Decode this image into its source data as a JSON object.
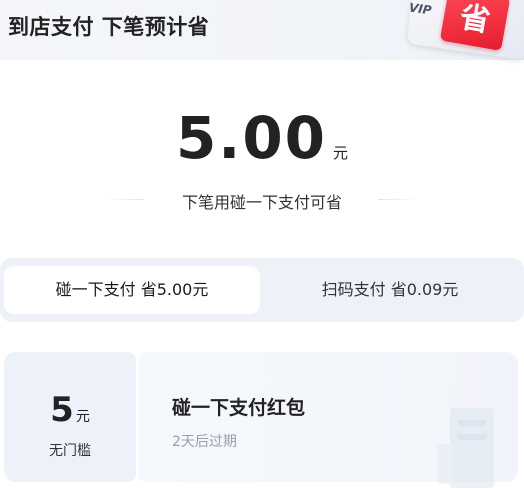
{
  "header": {
    "title": "到店支付 下笔预计省",
    "badge_text": "VIP",
    "sticker_text": "省"
  },
  "savings": {
    "amount": "5.00",
    "unit": "元",
    "description": "下笔用碰一下支付可省"
  },
  "tabs": [
    {
      "label": "碰一下支付 省5.00元",
      "active": true
    },
    {
      "label": "扫码支付 省0.09元",
      "active": false
    }
  ],
  "coupon": {
    "value": "5",
    "unit": "元",
    "threshold": "无门槛",
    "title": "碰一下支付红包",
    "expiry": "2天后过期"
  },
  "colors": {
    "accent_red": "#e51d2e",
    "tab_background": "#eef2f8",
    "coupon_background": "#edf2fa",
    "muted_text": "#9aa0aa"
  }
}
